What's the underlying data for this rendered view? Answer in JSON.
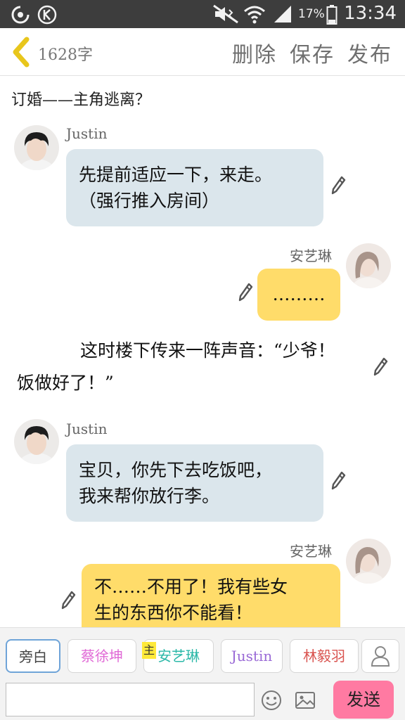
{
  "status_bar": {
    "battery_percent": "17%",
    "time": "13:34"
  },
  "header": {
    "word_count": "1628字",
    "delete_label": "删除",
    "save_label": "保存",
    "publish_label": "发布"
  },
  "story_title": "订婚——主角逃离？",
  "messages": [
    {
      "speaker": "Justin",
      "lines": [
        "先提前适应一下，来走。",
        "（强行推入房间）"
      ]
    },
    {
      "speaker": "安艺琳",
      "lines": [
        "………"
      ]
    },
    {
      "narration": "这时楼下传来一阵声音：“少爷！饭做好了！”"
    },
    {
      "speaker": "Justin",
      "lines": [
        "宝贝，你先下去吃饭吧，",
        "我来帮你放行李。"
      ]
    },
    {
      "speaker": "安艺琳",
      "lines": [
        "不……不用了！我有些女",
        "生的东西你不能看！"
      ]
    }
  ],
  "roles": [
    {
      "label": "旁白",
      "color": "#444444"
    },
    {
      "label": "蔡徐坤",
      "color": "#e06ad6"
    },
    {
      "label": "安艺琳",
      "color": "#2bb8a8",
      "tag": "主"
    },
    {
      "label": "Justin",
      "color": "#9a6ad6"
    },
    {
      "label": "林毅羽",
      "color": "#d9534f"
    }
  ],
  "input": {
    "value": "",
    "placeholder": ""
  },
  "send_label": "发送"
}
